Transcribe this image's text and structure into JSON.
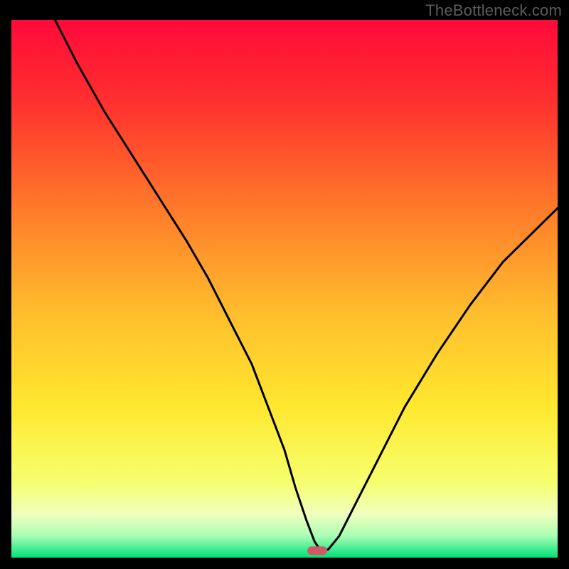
{
  "watermark": "TheBottleneck.com",
  "chart_data": {
    "type": "line",
    "title": "",
    "xlabel": "",
    "ylabel": "",
    "xlim": [
      0,
      100
    ],
    "ylim": [
      0,
      100
    ],
    "background_gradient_stops": [
      {
        "offset": 0.0,
        "color": "#ff0a3a"
      },
      {
        "offset": 0.15,
        "color": "#ff2f2f"
      },
      {
        "offset": 0.35,
        "color": "#ff7a2a"
      },
      {
        "offset": 0.55,
        "color": "#ffbf2d"
      },
      {
        "offset": 0.72,
        "color": "#ffe82f"
      },
      {
        "offset": 0.86,
        "color": "#f6ff6e"
      },
      {
        "offset": 0.92,
        "color": "#f0ffbf"
      },
      {
        "offset": 0.96,
        "color": "#a7ffb3"
      },
      {
        "offset": 1.0,
        "color": "#00e07a"
      }
    ],
    "series": [
      {
        "name": "bottleneck-curve",
        "x": [
          8,
          12,
          17,
          22,
          27,
          32,
          36,
          40,
          44,
          47,
          50,
          52,
          54,
          55.5,
          56.5,
          58,
          60,
          63,
          67,
          72,
          78,
          84,
          90,
          96,
          100
        ],
        "y": [
          100,
          92,
          83,
          75,
          67,
          59,
          52,
          44,
          36,
          28,
          20,
          13,
          7,
          3,
          1.5,
          1.5,
          4,
          10,
          18,
          28,
          38,
          47,
          55,
          61,
          65
        ]
      }
    ],
    "marker": {
      "name": "optimal-marker",
      "x": 56,
      "y": 1.3,
      "color": "#d15a62",
      "rx": 6,
      "width": 28,
      "height": 12
    }
  }
}
